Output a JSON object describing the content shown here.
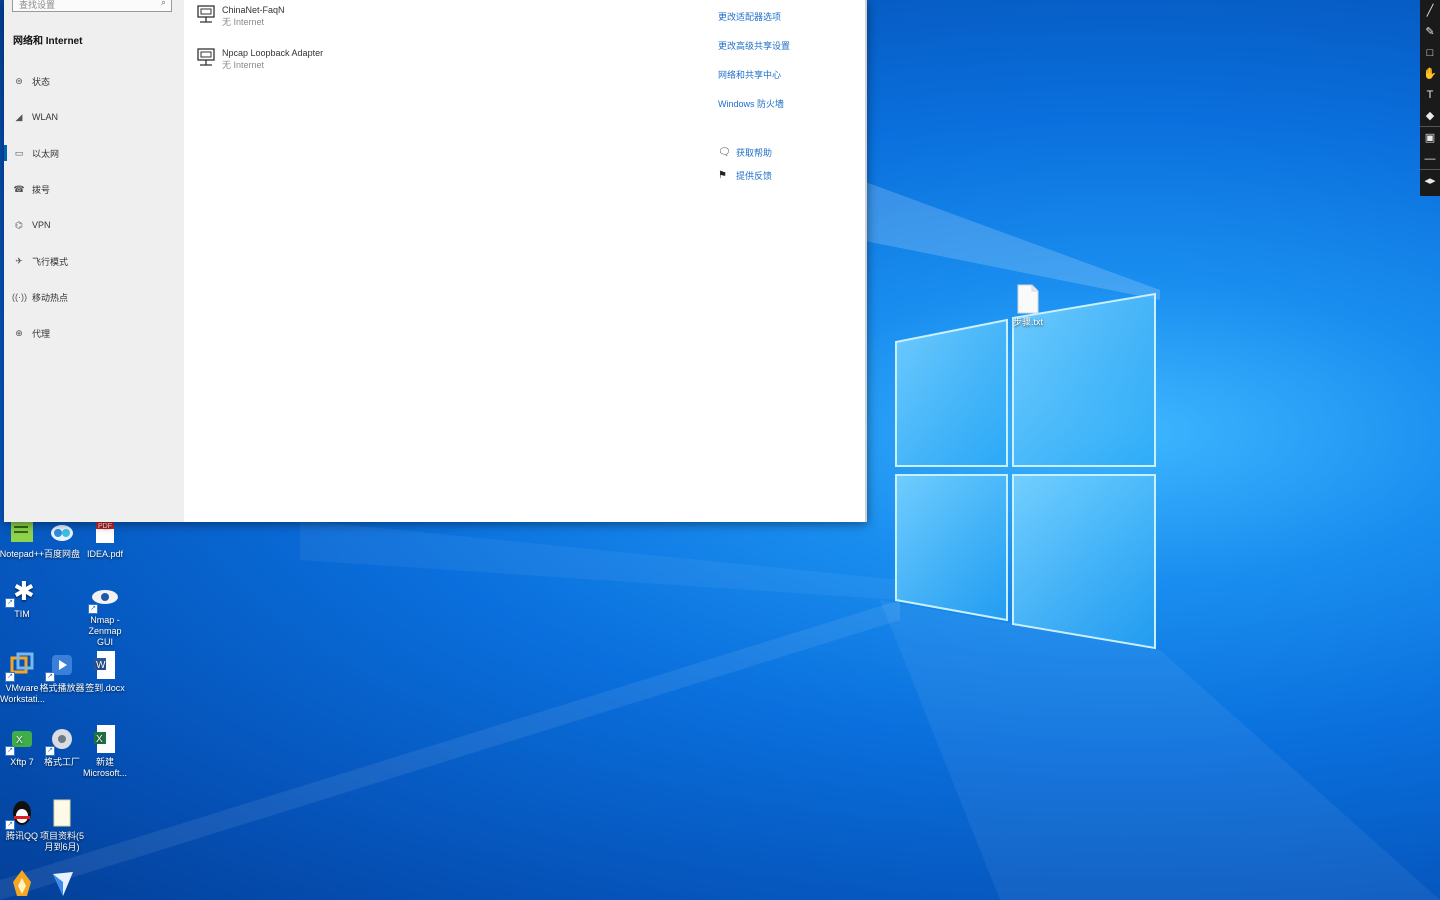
{
  "settings_window": {
    "search_placeholder": "查找设置",
    "sidebar_title": "网络和 Internet",
    "nav_items": [
      {
        "label": "状态",
        "icon": "status-icon"
      },
      {
        "label": "WLAN",
        "icon": "wifi-icon"
      },
      {
        "label": "以太网",
        "icon": "ethernet-icon"
      },
      {
        "label": "拨号",
        "icon": "dialup-icon"
      },
      {
        "label": "VPN",
        "icon": "vpn-icon"
      },
      {
        "label": "飞行模式",
        "icon": "airplane-icon"
      },
      {
        "label": "移动热点",
        "icon": "hotspot-icon"
      },
      {
        "label": "代理",
        "icon": "proxy-icon"
      }
    ],
    "active_nav": "以太网",
    "adapters": [
      {
        "name": "ChinaNet-FaqN",
        "status": "无 Internet"
      },
      {
        "name": "Npcap Loopback Adapter",
        "status": "无 Internet"
      }
    ],
    "related_links": [
      "更改适配器选项",
      "更改高级共享设置",
      "网络和共享中心",
      "Windows 防火墙"
    ],
    "help_links": [
      {
        "label": "获取帮助",
        "icon": "help-icon"
      },
      {
        "label": "提供反馈",
        "icon": "feedback-icon"
      }
    ]
  },
  "desktop_icons": [
    {
      "label": "Notepad++",
      "icon": "notepadpp-icon"
    },
    {
      "label": "百度网盘",
      "icon": "baidu-netdisk-icon"
    },
    {
      "label": "IDEA.pdf",
      "icon": "pdf-file-icon"
    },
    {
      "label": "TIM",
      "icon": "tim-icon"
    },
    {
      "label": "Nmap - Zenmap GUI",
      "icon": "nmap-icon"
    },
    {
      "label": "VMware Workstati...",
      "icon": "vmware-icon"
    },
    {
      "label": "格式播放器",
      "icon": "player-icon"
    },
    {
      "label": "签到.docx",
      "icon": "word-file-icon"
    },
    {
      "label": "Xftp 7",
      "icon": "xftp-icon"
    },
    {
      "label": "格式工厂",
      "icon": "format-factory-icon"
    },
    {
      "label": "新建 Microsoft...",
      "icon": "excel-file-icon"
    },
    {
      "label": "腾讯QQ",
      "icon": "qq-icon"
    },
    {
      "label": "项目资料(5月到6月)",
      "icon": "folder-icon"
    },
    {
      "label": "",
      "icon": "app-icon"
    },
    {
      "label": "",
      "icon": "feishu-icon"
    }
  ],
  "desktop_file": {
    "label": "步骤.txt",
    "icon": "text-file-icon"
  },
  "colors": {
    "accent": "#0063b1",
    "link": "#1f6fc9",
    "desktop": "#0a6fdc"
  },
  "annotation_tools": [
    "pen-icon",
    "marker-icon",
    "rectangle-icon",
    "hand-icon",
    "text-icon",
    "eraser-icon",
    "white-board-icon",
    "minimize-icon",
    "expand-icon"
  ]
}
